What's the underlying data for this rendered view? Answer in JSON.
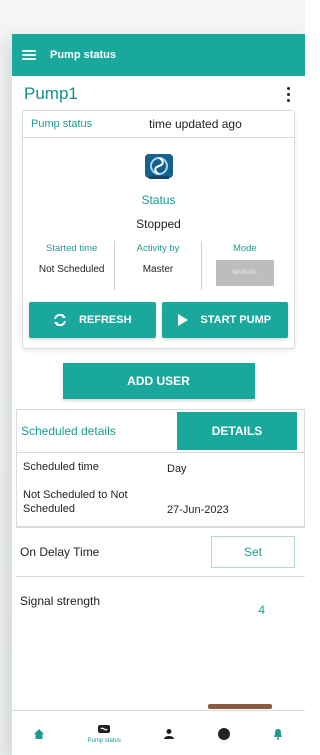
{
  "appbar": {
    "title": "Pump status"
  },
  "header": {
    "pump_name": "Pump1"
  },
  "status_card": {
    "label": "Pump status",
    "time_updated": "time updated ago",
    "status_label": "Status",
    "status_value": "Stopped",
    "started_time_label": "Started time",
    "started_time_value": "Not Scheduled",
    "activity_label": "Activity by",
    "activity_value": "Master",
    "mode_label": "Mode",
    "mode_value": "MANUAL"
  },
  "actions": {
    "refresh": "REFRESH",
    "start_pump": "START PUMP",
    "add_user": "ADD USER"
  },
  "scheduled": {
    "label": "Scheduled details",
    "details_button": "DETAILS",
    "rows": [
      {
        "key": "Scheduled time",
        "value": "Day"
      },
      {
        "key": "Not Scheduled to Not Scheduled",
        "value": "27-Jun-2023"
      }
    ]
  },
  "on_delay": {
    "label": "On Delay Time",
    "button": "Set"
  },
  "signal": {
    "label": "Signal strength",
    "value": "4"
  },
  "bottom_nav": {
    "pump_status": "Pump status"
  },
  "colors": {
    "primary": "#1aa89d",
    "accent": "#8b5a3c"
  },
  "icons": [
    "menu-icon",
    "more-vert-icon",
    "pump-icon",
    "refresh-icon",
    "play-icon",
    "home-icon",
    "user-icon",
    "bell-icon"
  ]
}
